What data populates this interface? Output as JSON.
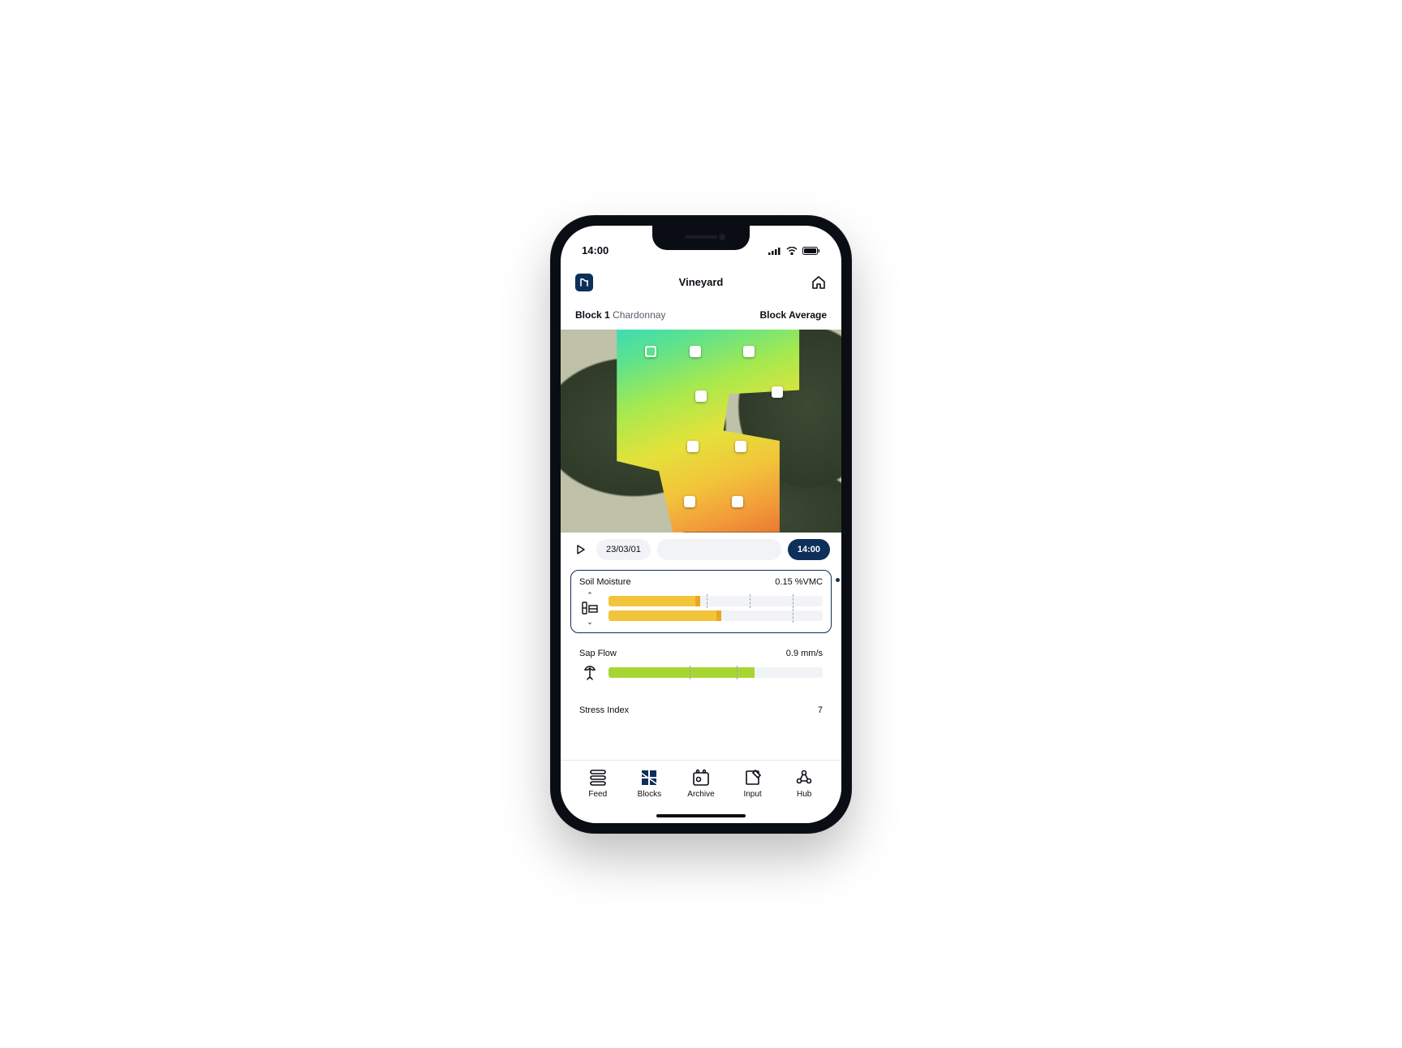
{
  "status_bar": {
    "time": "14:00"
  },
  "header": {
    "title": "Vineyard"
  },
  "sub_header": {
    "block_prefix": "Block 1",
    "block_suffix": "Chardonnay",
    "right": "Block Average"
  },
  "timeline": {
    "date": "23/03/01",
    "time": "14:00"
  },
  "metrics": [
    {
      "title": "Soil Moisture",
      "value": "0.15 %VMC",
      "active": true,
      "bars": [
        {
          "fill_pct": 42,
          "color": "yellow",
          "ticks_pct": [
            46,
            66,
            86
          ]
        },
        {
          "fill_pct": 52,
          "color": "yellow",
          "ticks_pct": [
            86
          ]
        }
      ]
    },
    {
      "title": "Sap Flow",
      "value": "0.9 mm/s",
      "active": false,
      "bars": [
        {
          "fill_pct": 68,
          "color": "green",
          "ticks_pct": [
            38,
            60
          ]
        }
      ]
    },
    {
      "title": "Stress Index",
      "value": "7",
      "active": false,
      "bars": []
    }
  ],
  "nav": {
    "items": [
      {
        "label": "Feed"
      },
      {
        "label": "Blocks"
      },
      {
        "label": "Archive"
      },
      {
        "label": "Input"
      },
      {
        "label": "Hub"
      }
    ]
  },
  "sensor_markers": [
    {
      "left_pct": 30,
      "top_pct": 8,
      "outline": true
    },
    {
      "left_pct": 46,
      "top_pct": 8,
      "outline": false
    },
    {
      "left_pct": 65,
      "top_pct": 8,
      "outline": false
    },
    {
      "left_pct": 75,
      "top_pct": 28,
      "outline": false
    },
    {
      "left_pct": 48,
      "top_pct": 30,
      "outline": false
    },
    {
      "left_pct": 45,
      "top_pct": 55,
      "outline": false
    },
    {
      "left_pct": 62,
      "top_pct": 55,
      "outline": false
    },
    {
      "left_pct": 44,
      "top_pct": 82,
      "outline": false
    },
    {
      "left_pct": 61,
      "top_pct": 82,
      "outline": false
    }
  ]
}
